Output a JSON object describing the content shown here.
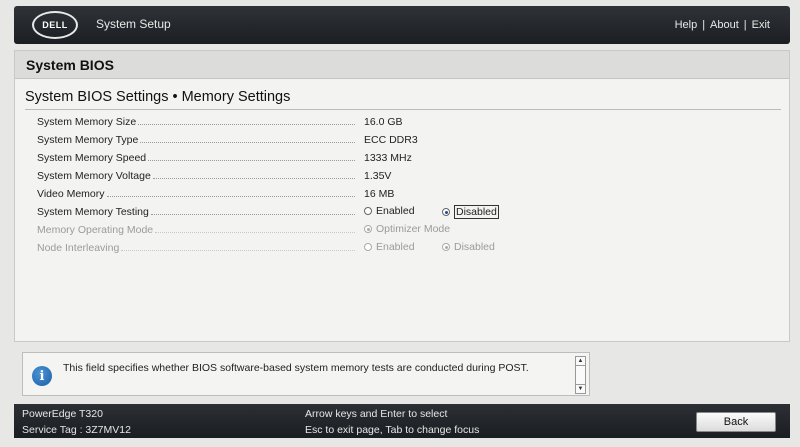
{
  "header": {
    "logo_text": "DELL",
    "app_title": "System Setup",
    "links": [
      "Help",
      "About",
      "Exit"
    ],
    "link_separator": "|"
  },
  "section": {
    "title": "System BIOS",
    "breadcrumb": "System BIOS Settings • Memory Settings"
  },
  "settings": {
    "memory_size": {
      "label": "System Memory Size",
      "value": "16.0 GB"
    },
    "memory_type": {
      "label": "System Memory Type",
      "value": "ECC DDR3"
    },
    "memory_speed": {
      "label": "System Memory Speed",
      "value": "1333 MHz"
    },
    "memory_voltage": {
      "label": "System Memory Voltage",
      "value": "1.35V"
    },
    "video_memory": {
      "label": "Video Memory",
      "value": "16 MB"
    },
    "memory_testing": {
      "label": "System Memory Testing",
      "options": [
        "Enabled",
        "Disabled"
      ],
      "selected": "Disabled"
    },
    "operating_mode": {
      "label": "Memory Operating Mode",
      "options": [
        "Optimizer Mode"
      ],
      "selected": "Optimizer Mode",
      "enabled": false
    },
    "node_interleaving": {
      "label": "Node Interleaving",
      "options": [
        "Enabled",
        "Disabled"
      ],
      "selected": "Disabled",
      "enabled": false
    }
  },
  "help": {
    "icon": "info-icon",
    "text": "This field specifies whether BIOS software-based system memory tests are conducted during POST."
  },
  "footer": {
    "model": "PowerEdge T320",
    "service_tag": "Service Tag : 3Z7MV12",
    "hint_line1": "Arrow keys and Enter to select",
    "hint_line2": "Esc to exit page, Tab to change focus",
    "back_label": "Back"
  },
  "colors": {
    "header_bg": "#1f2226",
    "page_bg": "#e7e7e5",
    "accent": "#1d5ea5"
  }
}
